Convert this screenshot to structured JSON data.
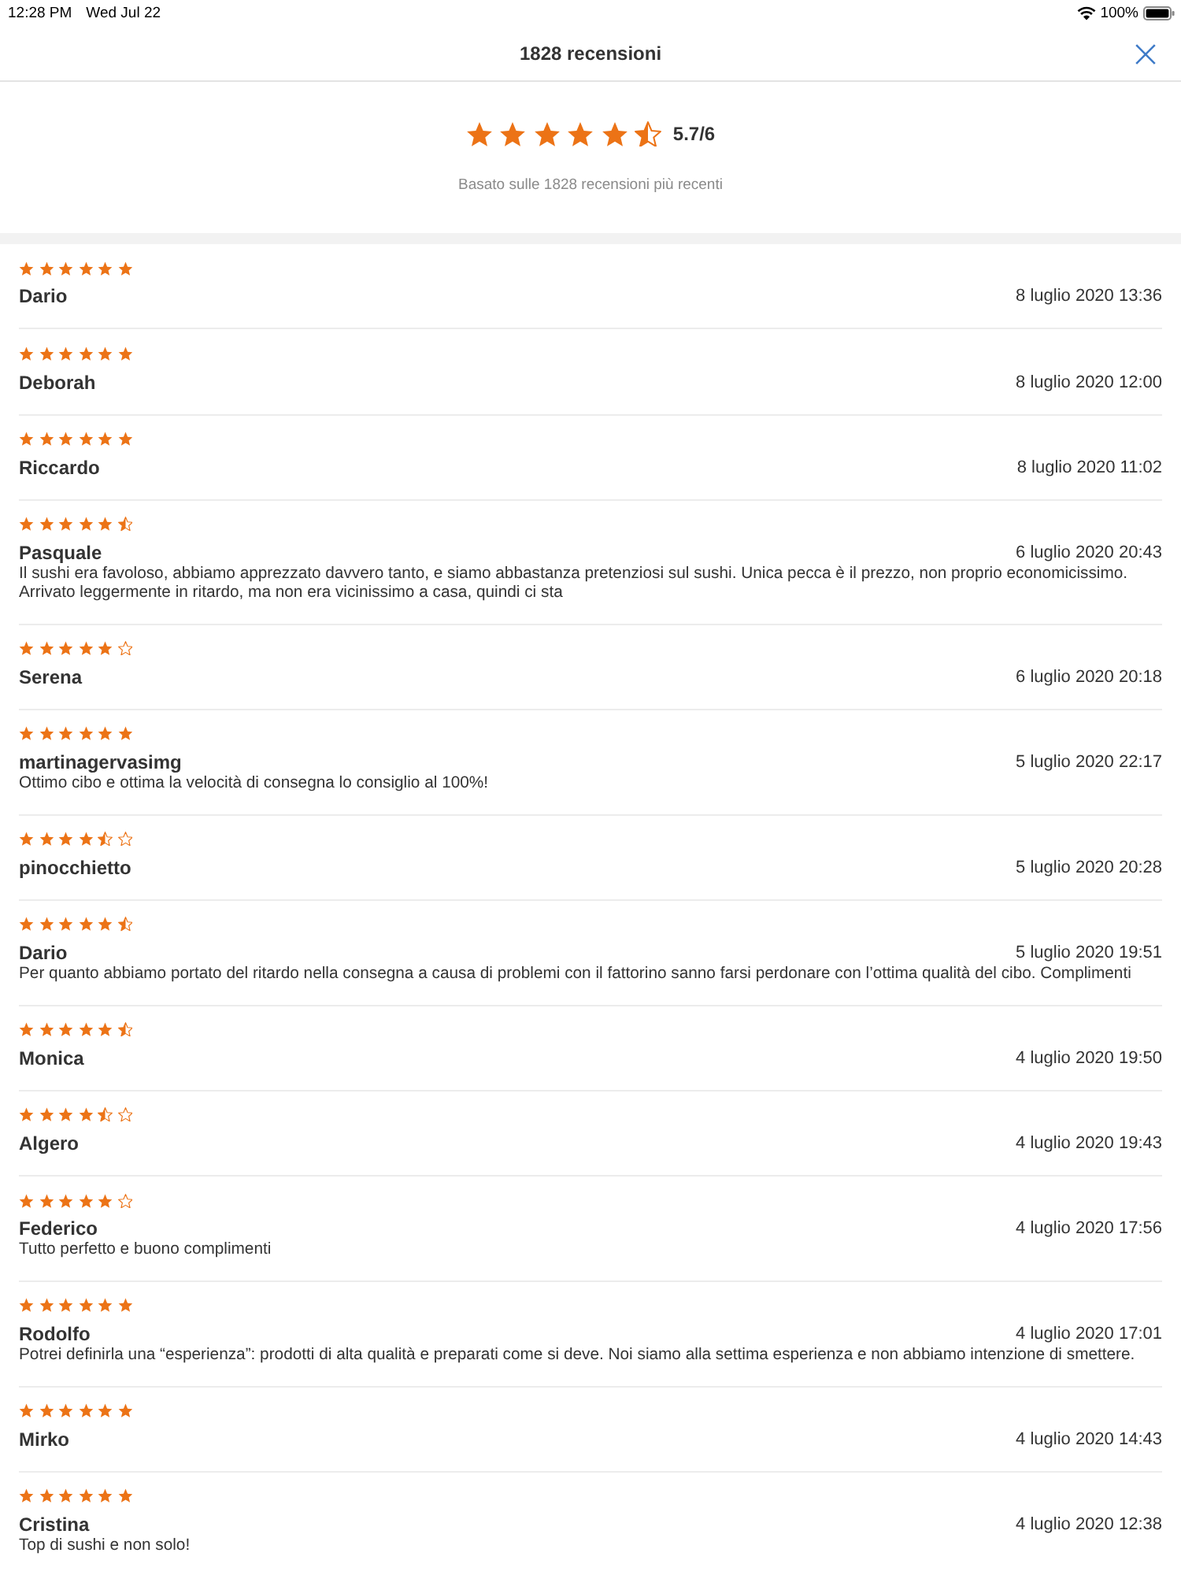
{
  "status_bar": {
    "time": "12:28 PM",
    "date": "Wed Jul 22",
    "battery": "100%"
  },
  "header": {
    "title": "1828 recensioni"
  },
  "summary": {
    "stars": 5.5,
    "score": "5.7/6",
    "note": "Basato sulle 1828 recensioni più recenti"
  },
  "reviews": [
    {
      "stars": 6,
      "name": "Dario",
      "date": "8 luglio 2020 13:36"
    },
    {
      "stars": 6,
      "name": "Deborah",
      "date": "8 luglio 2020 12:00"
    },
    {
      "stars": 6,
      "name": "Riccardo",
      "date": "8 luglio 2020 11:02"
    },
    {
      "stars": 5.5,
      "name": "Pasquale",
      "date": "6 luglio 2020 20:43",
      "text": "Il sushi era favoloso, abbiamo apprezzato davvero tanto, e siamo abbastanza pretenziosi sul sushi. Unica pecca è il prezzo, non proprio economicissimo. Arrivato leggermente in ritardo, ma non era vicinissimo a casa, quindi ci sta"
    },
    {
      "stars": 5,
      "name": "Serena",
      "date": "6 luglio 2020 20:18"
    },
    {
      "stars": 6,
      "name": "martinagervasimg",
      "date": "5 luglio 2020 22:17",
      "text": "Ottimo cibo e ottima la velocità di consegna lo consiglio al 100%!"
    },
    {
      "stars": 4.5,
      "name": "pinocchietto",
      "date": "5 luglio 2020 20:28"
    },
    {
      "stars": 5.5,
      "name": "Dario",
      "date": "5 luglio 2020 19:51",
      "text": "Per quanto abbiamo portato del ritardo nella consegna a causa di problemi con il fattorino sanno farsi perdonare con l’ottima qualità del cibo. Complimenti"
    },
    {
      "stars": 5.5,
      "name": "Monica",
      "date": "4 luglio 2020 19:50"
    },
    {
      "stars": 4.5,
      "name": "Algero",
      "date": "4 luglio 2020 19:43"
    },
    {
      "stars": 5,
      "name": "Federico",
      "date": "4 luglio 2020 17:56",
      "text": "Tutto perfetto e buono complimenti"
    },
    {
      "stars": 6,
      "name": "Rodolfo",
      "date": "4 luglio 2020 17:01",
      "text": "Potrei definirla una “esperienza”: prodotti di alta qualità e preparati come si deve. Noi siamo alla settima esperienza e non abbiamo intenzione di smettere."
    },
    {
      "stars": 6,
      "name": "Mirko",
      "date": "4 luglio 2020 14:43"
    },
    {
      "stars": 6,
      "name": "Cristina",
      "date": "4 luglio 2020 12:38",
      "text": "Top di sushi e non solo!"
    }
  ]
}
